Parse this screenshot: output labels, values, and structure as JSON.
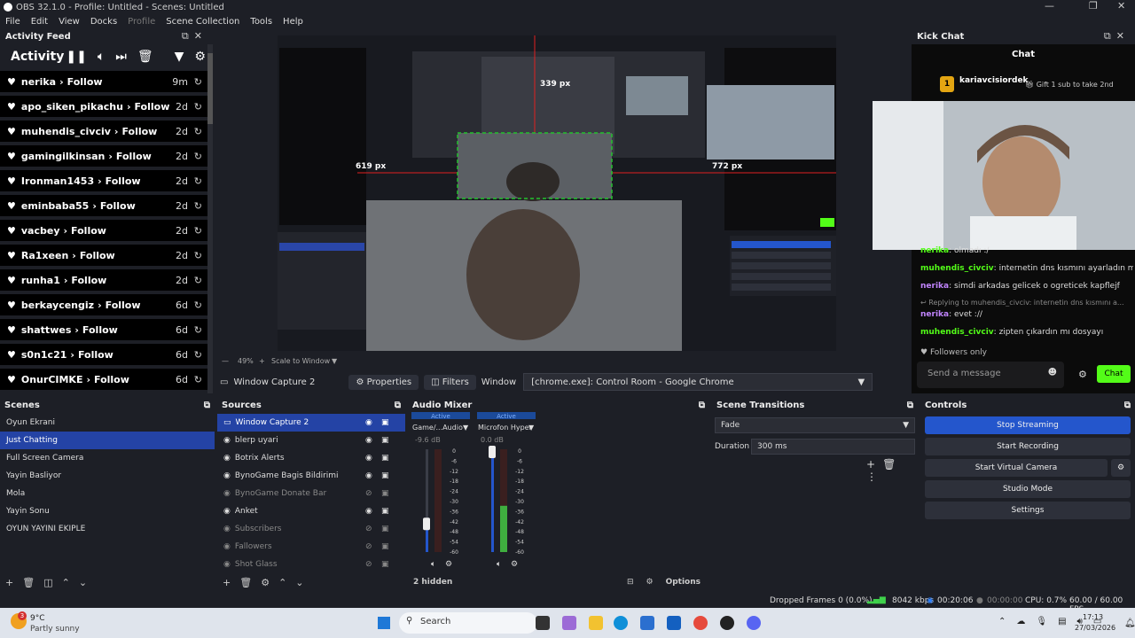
{
  "window": {
    "title": "OBS 32.1.0 - Profile: Untitled - Scenes: Untitled",
    "controls": [
      "—",
      "❐",
      "✕"
    ]
  },
  "menu": [
    "File",
    "Edit",
    "View",
    "Docks",
    "Profile",
    "Scene Collection",
    "Tools",
    "Help"
  ],
  "activity_feed": {
    "dock_title": "Activity Feed",
    "heading": "Activity",
    "items": [
      {
        "user": "nerika",
        "action": "Follow",
        "time": "9m"
      },
      {
        "user": "apo_siken_pikachu",
        "action": "Follow",
        "time": "2d"
      },
      {
        "user": "muhendis_civciv",
        "action": "Follow",
        "time": "2d"
      },
      {
        "user": "gamingilkinsan",
        "action": "Follow",
        "time": "2d"
      },
      {
        "user": "Ironman1453",
        "action": "Follow",
        "time": "2d"
      },
      {
        "user": "eminbaba55",
        "action": "Follow",
        "time": "2d"
      },
      {
        "user": "vacbey",
        "action": "Follow",
        "time": "2d"
      },
      {
        "user": "Ra1xeen",
        "action": "Follow",
        "time": "2d"
      },
      {
        "user": "runha1",
        "action": "Follow",
        "time": "2d"
      },
      {
        "user": "berkaycengiz",
        "action": "Follow",
        "time": "6d"
      },
      {
        "user": "shattwes",
        "action": "Follow",
        "time": "6d"
      },
      {
        "user": "s0n1c21",
        "action": "Follow",
        "time": "6d"
      },
      {
        "user": "OnurCIMKE",
        "action": "Follow",
        "time": "6d"
      }
    ]
  },
  "preview": {
    "measure_labels": [
      "339 px",
      "619 px",
      "772 px"
    ],
    "zoom": "49%",
    "scale_option": "Scale to Window"
  },
  "source_toolbar": {
    "source_name": "Window Capture 2",
    "properties_label": "Properties",
    "filters_label": "Filters",
    "window_label": "Window",
    "window_value": "[chrome.exe]: Control Room - Google Chrome"
  },
  "kick_chat": {
    "dock_title": "Kick Chat",
    "chat_title": "Chat",
    "top_gifter": "kariavcisiordek",
    "top_gifter_count": "1",
    "gift_prompt": "Gift 1 sub to take 2nd",
    "messages": [
      {
        "user": "nerika",
        "text": "olmadı :/"
      },
      {
        "user": "muhendis_civciv",
        "text": "internetin dns kısmını ayarladın mı"
      },
      {
        "user": "nerika",
        "text": "simdi arkadas gelicek o ogreticek kapflejf"
      },
      {
        "user": "nerika",
        "text": "evet ://"
      },
      {
        "user": "muhendis_civciv",
        "text": "zipten çıkardın mı dosyayı"
      }
    ],
    "reply_note": "Replying to muhendis_civciv: internetin dns kısmını a...",
    "mode": "Followers only",
    "input_placeholder": "Send a message",
    "send_label": "Chat"
  },
  "scenes": {
    "title": "Scenes",
    "items": [
      "Oyun Ekrani",
      "Just Chatting",
      "Full Screen Camera",
      "Yayin Basliyor",
      "Mola",
      "Yayin Sonu",
      "OYUN YAYINI EKIPLE"
    ],
    "selected": 1
  },
  "sources": {
    "title": "Sources",
    "items": [
      {
        "name": "Window Capture 2",
        "visible": true
      },
      {
        "name": "blerp uyari",
        "visible": true
      },
      {
        "name": "Botrix Alerts",
        "visible": true
      },
      {
        "name": "BynoGame Bagis Bildirimi",
        "visible": true
      },
      {
        "name": "BynoGame Donate Bar",
        "visible": false
      },
      {
        "name": "Anket",
        "visible": true
      },
      {
        "name": "Subscribers",
        "visible": false
      },
      {
        "name": "Fallowers",
        "visible": false
      },
      {
        "name": "Shot Glass",
        "visible": false
      }
    ]
  },
  "audio_mixer": {
    "title": "Audio Mixer",
    "channels": [
      {
        "name": "Game/...Audio",
        "status": "Active",
        "db": "-9.6 dB",
        "fader": 0.3,
        "level": 0.0
      },
      {
        "name": "Microfon Hyper",
        "status": "Active",
        "db": "0.0 dB",
        "fader": 1.0,
        "level": 0.45
      }
    ],
    "scale": [
      "0",
      "-6",
      "-12",
      "-18",
      "-24",
      "-30",
      "-36",
      "-42",
      "-48",
      "-54",
      "-60"
    ],
    "hidden_label": "2 hidden",
    "options_label": "Options"
  },
  "transitions": {
    "title": "Scene Transitions",
    "selected": "Fade",
    "duration_label": "Duration",
    "duration_value": "300 ms"
  },
  "controls": {
    "title": "Controls",
    "buttons": [
      "Stop Streaming",
      "Start Recording",
      "Start Virtual Camera",
      "Studio Mode",
      "Settings"
    ]
  },
  "status_bar": {
    "dropped": "Dropped Frames 0 (0.0%)",
    "bitrate": "8042 kbps",
    "stream_time": "00:20:06",
    "rec_time": "00:00:00",
    "cpu": "CPU: 0.7%",
    "fps": "60.00 / 60.00 FPS"
  },
  "taskbar": {
    "weather_temp": "9°C",
    "weather_desc": "Partly sunny",
    "weather_badge": "3",
    "search_placeholder": "Search",
    "time": "17:13",
    "date": "27/03/2026"
  },
  "colors": {
    "accent": "#2456cc",
    "kick_green": "#53fc18",
    "dock_bg": "#1d1f26",
    "feed_row": "#000000"
  }
}
